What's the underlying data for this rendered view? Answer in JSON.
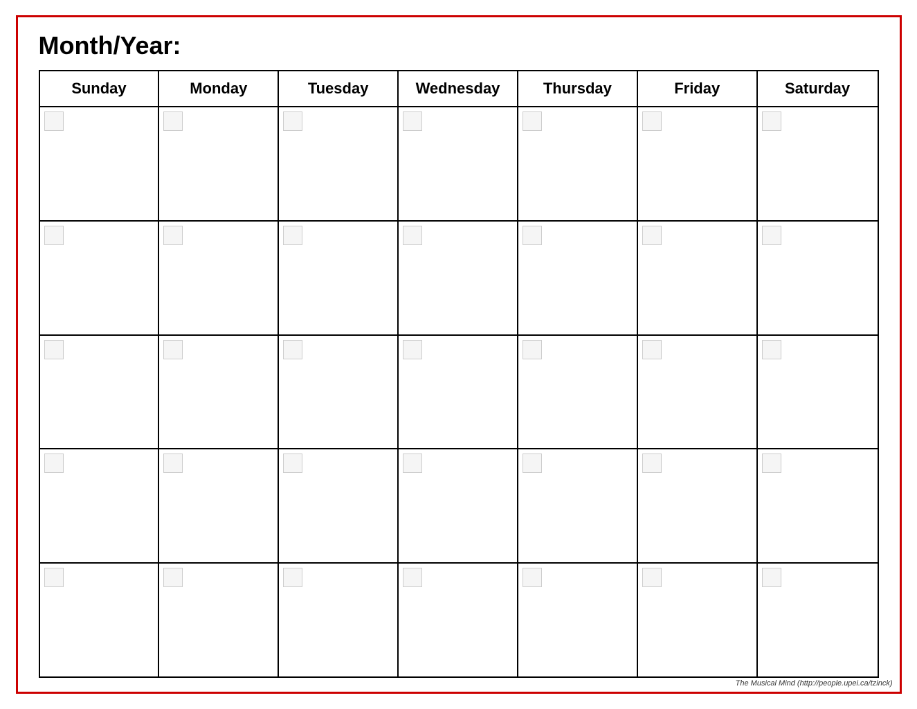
{
  "header": {
    "month_year_label": "Month/Year:"
  },
  "calendar": {
    "days": [
      "Sunday",
      "Monday",
      "Tuesday",
      "Wednesday",
      "Thursday",
      "Friday",
      "Saturday"
    ],
    "num_weeks": 5
  },
  "footer": {
    "text": "The Musical Mind   (http://people.upei.ca/tzinck)"
  }
}
